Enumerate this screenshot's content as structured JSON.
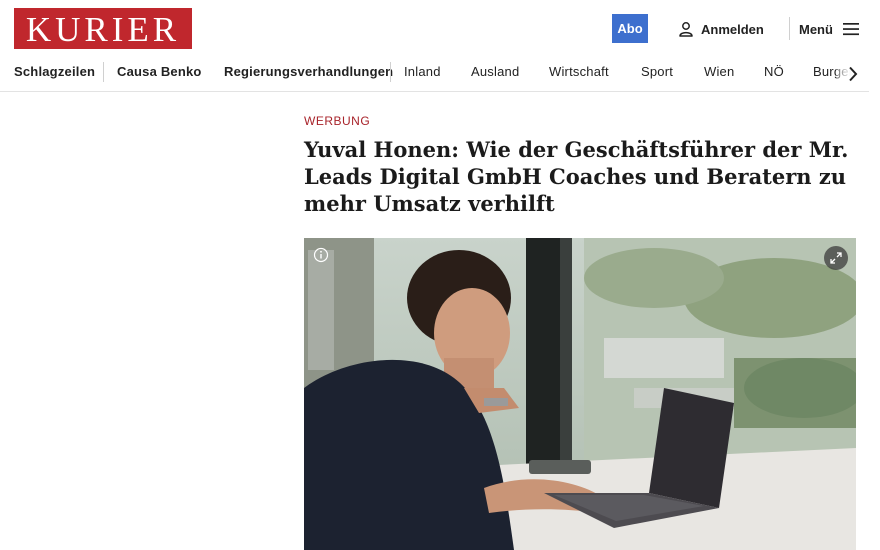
{
  "header": {
    "logo_text": "KURIER",
    "abo_label": "Abo",
    "login_label": "Anmelden",
    "menu_label": "Menü",
    "login_icon": "user-icon",
    "menu_icon": "hamburger-icon"
  },
  "nav": {
    "items": [
      {
        "label": "Schlagzeilen"
      },
      {
        "label": "Causa Benko"
      },
      {
        "label": "Regierungsverhandlungen"
      },
      {
        "label": "Inland"
      },
      {
        "label": "Ausland"
      },
      {
        "label": "Wirtschaft"
      },
      {
        "label": "Sport"
      },
      {
        "label": "Wien"
      },
      {
        "label": "NÖ"
      },
      {
        "label": "Burgenland"
      }
    ],
    "scroll_icon": "chevron-right-icon"
  },
  "article": {
    "kicker": "WERBUNG",
    "headline": "Yuval Honen: Wie der Geschäftsführer der Mr. Leads Digital GmbH Coaches und Beratern zu mehr Umsatz verhilft",
    "image_icons": [
      "info-icon",
      "expand-icon"
    ]
  },
  "colors": {
    "brand_red": "#c0272d",
    "abo_blue": "#3d6fce",
    "kicker_red": "#a8232a"
  }
}
